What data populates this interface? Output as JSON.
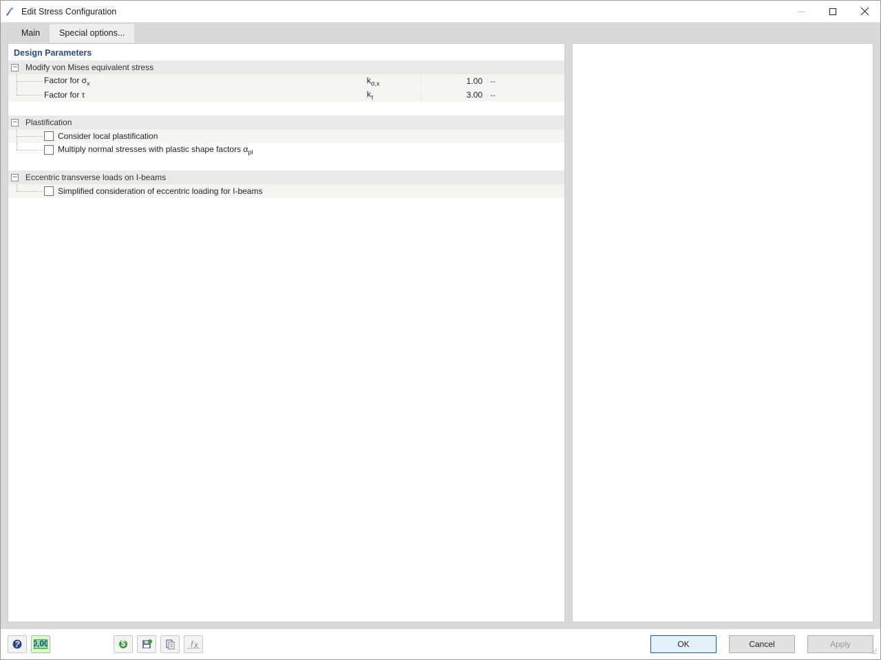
{
  "window": {
    "title": "Edit Stress Configuration"
  },
  "tabs": {
    "main": "Main",
    "special": "Special options..."
  },
  "section_title": "Design Parameters",
  "groups": {
    "von_mises": {
      "header": "Modify von Mises equivalent stress",
      "rows": [
        {
          "label_html": "Factor for σ",
          "label_sub": "x",
          "symbol_html": "k",
          "symbol_sub": "σ,x",
          "value": "1.00",
          "unit": "--"
        },
        {
          "label_html": "Factor for τ",
          "label_sub": "",
          "symbol_html": "k",
          "symbol_sub": "τ",
          "value": "3.00",
          "unit": "--"
        }
      ]
    },
    "plastification": {
      "header": "Plastification",
      "rows": [
        {
          "checkbox": true,
          "checked": false,
          "label": "Consider local plastification"
        },
        {
          "checkbox": true,
          "checked": false,
          "label_html": "Multiply normal stresses with plastic shape factors α",
          "label_sub": "pl"
        }
      ]
    },
    "eccentric": {
      "header": "Eccentric transverse loads on I-beams",
      "rows": [
        {
          "checkbox": true,
          "checked": false,
          "label": "Simplified consideration of eccentric loading for I-beams"
        }
      ]
    }
  },
  "buttons": {
    "ok": "OK",
    "cancel": "Cancel",
    "apply": "Apply"
  },
  "footer_icons": [
    "help-icon",
    "units-icon",
    "currency-icon",
    "save-icon",
    "clipboard-icon",
    "fx-icon"
  ]
}
